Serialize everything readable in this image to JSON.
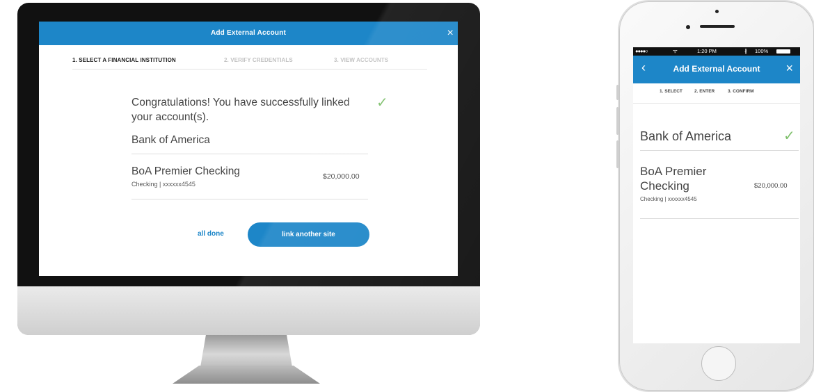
{
  "desktop": {
    "header_title": "Add External Account",
    "close_icon": "×",
    "steps": [
      "1. SELECT A FINANCIAL INSTITUTION",
      "2. VERIFY CREDENTIALS",
      "3. VIEW ACCOUNTS"
    ],
    "success_message": "Congratulations! You have successfully linked your account(s).",
    "check_icon": "✓",
    "bank_name": "Bank of America",
    "account_name": "BoA Premier Checking",
    "account_detail": "Checking | xxxxxx4545",
    "account_balance": "$20,000.00",
    "all_done_label": "all done",
    "link_another_label": "link another site"
  },
  "phone": {
    "status": {
      "signal": "●●●●○",
      "wifi": "ᯤ",
      "time": "1:20 PM",
      "bluetooth": "∦",
      "battery": "100%"
    },
    "back_icon": "‹",
    "header_title": "Add External Account",
    "close_icon": "×",
    "steps": [
      "1. SELECT",
      "2. ENTER",
      "3. CONFIRM"
    ],
    "bank_name": "Bank of America",
    "check_icon": "✓",
    "account_name": "BoA Premier Checking",
    "account_detail": "Checking | xxxxxx4545",
    "account_balance": "$20,000.00"
  },
  "colors": {
    "accent": "#1d86c8",
    "success": "#7ec06b"
  }
}
